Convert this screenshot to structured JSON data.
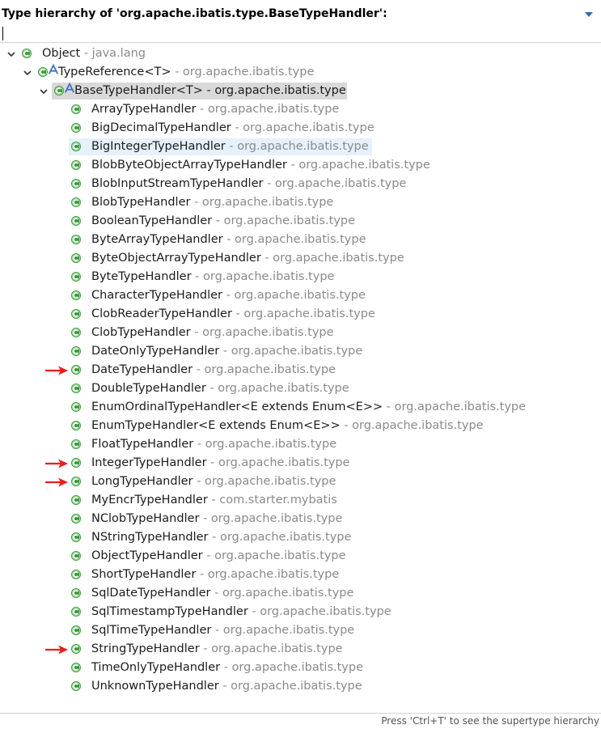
{
  "header": {
    "title": "Type hierarchy of 'org.apache.ibatis.type.BaseTypeHandler':"
  },
  "filter": {
    "value": ""
  },
  "colors": {
    "class_icon": "#3a9c3a",
    "selected_bg": "#d9d9d9",
    "hover_bg": "#e5f1fb",
    "package_text": "#8a8a8a",
    "arrow": "#ee1c1c"
  },
  "tree": [
    {
      "name": "Object",
      "pkg": " - java.lang",
      "level": 0,
      "expanded": true,
      "icon": "class-icon"
    },
    {
      "name": "TypeReference<T>",
      "pkg": " - org.apache.ibatis.type",
      "level": 1,
      "expanded": true,
      "icon": "abstract-class-icon"
    },
    {
      "name": "BaseTypeHandler<T> - org.apache.ibatis.type",
      "pkg": "",
      "level": 2,
      "expanded": true,
      "icon": "abstract-class-icon",
      "selected": true
    },
    {
      "name": "ArrayTypeHandler",
      "pkg": " - org.apache.ibatis.type",
      "level": 3,
      "icon": "class-icon"
    },
    {
      "name": "BigDecimalTypeHandler",
      "pkg": " - org.apache.ibatis.type",
      "level": 3,
      "icon": "class-icon"
    },
    {
      "name": "BigIntegerTypeHandler",
      "pkg": " - org.apache.ibatis.type",
      "level": 3,
      "icon": "class-icon",
      "hover": true
    },
    {
      "name": "BlobByteObjectArrayTypeHandler",
      "pkg": " - org.apache.ibatis.type",
      "level": 3,
      "icon": "class-icon"
    },
    {
      "name": "BlobInputStreamTypeHandler",
      "pkg": " - org.apache.ibatis.type",
      "level": 3,
      "icon": "class-icon"
    },
    {
      "name": "BlobTypeHandler",
      "pkg": " - org.apache.ibatis.type",
      "level": 3,
      "icon": "class-icon"
    },
    {
      "name": "BooleanTypeHandler",
      "pkg": " - org.apache.ibatis.type",
      "level": 3,
      "icon": "class-icon"
    },
    {
      "name": "ByteArrayTypeHandler",
      "pkg": " - org.apache.ibatis.type",
      "level": 3,
      "icon": "class-icon"
    },
    {
      "name": "ByteObjectArrayTypeHandler",
      "pkg": " - org.apache.ibatis.type",
      "level": 3,
      "icon": "class-icon"
    },
    {
      "name": "ByteTypeHandler",
      "pkg": " - org.apache.ibatis.type",
      "level": 3,
      "icon": "class-icon"
    },
    {
      "name": "CharacterTypeHandler",
      "pkg": " - org.apache.ibatis.type",
      "level": 3,
      "icon": "class-icon"
    },
    {
      "name": "ClobReaderTypeHandler",
      "pkg": " - org.apache.ibatis.type",
      "level": 3,
      "icon": "class-icon"
    },
    {
      "name": "ClobTypeHandler",
      "pkg": " - org.apache.ibatis.type",
      "level": 3,
      "icon": "class-icon"
    },
    {
      "name": "DateOnlyTypeHandler",
      "pkg": " - org.apache.ibatis.type",
      "level": 3,
      "icon": "class-icon"
    },
    {
      "name": "DateTypeHandler",
      "pkg": " - org.apache.ibatis.type",
      "level": 3,
      "icon": "class-icon",
      "arrow": true
    },
    {
      "name": "DoubleTypeHandler",
      "pkg": " - org.apache.ibatis.type",
      "level": 3,
      "icon": "class-icon"
    },
    {
      "name": "EnumOrdinalTypeHandler<E extends Enum<E>>",
      "pkg": " - org.apache.ibatis.type",
      "level": 3,
      "icon": "class-icon"
    },
    {
      "name": "EnumTypeHandler<E extends Enum<E>>",
      "pkg": " - org.apache.ibatis.type",
      "level": 3,
      "icon": "class-icon"
    },
    {
      "name": "FloatTypeHandler",
      "pkg": " - org.apache.ibatis.type",
      "level": 3,
      "icon": "class-icon"
    },
    {
      "name": "IntegerTypeHandler",
      "pkg": " - org.apache.ibatis.type",
      "level": 3,
      "icon": "class-icon",
      "arrow": true
    },
    {
      "name": "LongTypeHandler",
      "pkg": " - org.apache.ibatis.type",
      "level": 3,
      "icon": "class-icon",
      "arrow": true
    },
    {
      "name": "MyEncrTypeHandler",
      "pkg": " - com.starter.mybatis",
      "level": 3,
      "icon": "class-icon"
    },
    {
      "name": "NClobTypeHandler",
      "pkg": " - org.apache.ibatis.type",
      "level": 3,
      "icon": "class-icon"
    },
    {
      "name": "NStringTypeHandler",
      "pkg": " - org.apache.ibatis.type",
      "level": 3,
      "icon": "class-icon"
    },
    {
      "name": "ObjectTypeHandler",
      "pkg": " - org.apache.ibatis.type",
      "level": 3,
      "icon": "class-icon"
    },
    {
      "name": "ShortTypeHandler",
      "pkg": " - org.apache.ibatis.type",
      "level": 3,
      "icon": "class-icon"
    },
    {
      "name": "SqlDateTypeHandler",
      "pkg": " - org.apache.ibatis.type",
      "level": 3,
      "icon": "class-icon"
    },
    {
      "name": "SqlTimestampTypeHandler",
      "pkg": " - org.apache.ibatis.type",
      "level": 3,
      "icon": "class-icon"
    },
    {
      "name": "SqlTimeTypeHandler",
      "pkg": " - org.apache.ibatis.type",
      "level": 3,
      "icon": "class-icon"
    },
    {
      "name": "StringTypeHandler",
      "pkg": " - org.apache.ibatis.type",
      "level": 3,
      "icon": "class-icon",
      "arrow": true
    },
    {
      "name": "TimeOnlyTypeHandler",
      "pkg": " - org.apache.ibatis.type",
      "level": 3,
      "icon": "class-icon"
    },
    {
      "name": "UnknownTypeHandler",
      "pkg": " - org.apache.ibatis.type",
      "level": 3,
      "icon": "class-icon"
    }
  ],
  "status": {
    "hint": "Press 'Ctrl+T' to see the supertype hierarchy"
  }
}
